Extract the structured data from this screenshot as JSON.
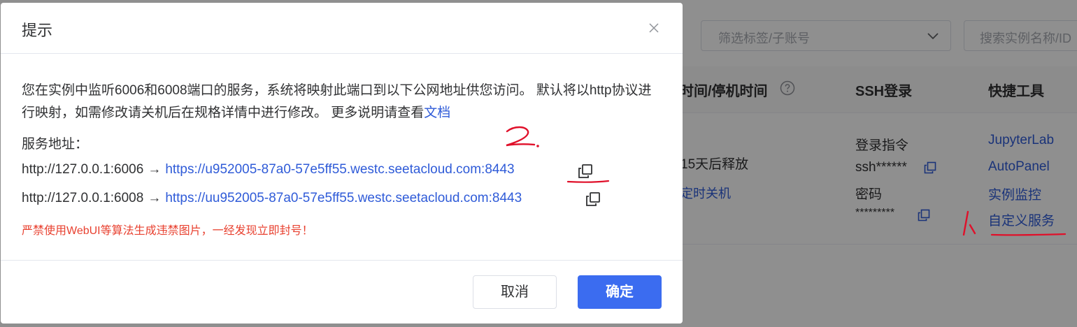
{
  "background": {
    "filter_select": {
      "placeholder": "筛选标签/子账号"
    },
    "search": {
      "placeholder": "搜索实例名称/ID"
    },
    "columns": {
      "time": "时间/停机时间",
      "ssh": "SSH登录",
      "tools": "快捷工具"
    },
    "row": {
      "release": "15天后释放",
      "shutdown_link": "定时关机",
      "ssh_login_label": "登录指令",
      "ssh_cmd": "ssh******",
      "password_label": "密码",
      "password_value": "*********",
      "tools": [
        "JupyterLab",
        "AutoPanel",
        "实例监控",
        "自定义服务"
      ]
    }
  },
  "dialog": {
    "title": "提示",
    "paragraph": "您在实例中监听6006和6008端口的服务，系统将映射此端口到以下公网地址供您访问。 默认将以http协议进行映射，如需修改请关机后在规格详情中进行修改。 更多说明请查看",
    "doc_link": "文档",
    "service_label": "服务地址：",
    "mappings": [
      {
        "local": "http://127.0.0.1:6006",
        "arrow": "→",
        "public": "https://u952005-87a0-57e5ff55.westc.seetacloud.com:8443"
      },
      {
        "local": "http://127.0.0.1:6008",
        "arrow": "→",
        "public": "https://uu952005-87a0-57e5ff55.westc.seetacloud.com:8443"
      }
    ],
    "warning": "严禁使用WebUI等算法生成违禁图片，一经发现立即封号！",
    "cancel_label": "取消",
    "ok_label": "确定"
  },
  "annotations": {
    "mark1": "1、",
    "mark2": "2."
  },
  "colors": {
    "primary": "#3b6cf0",
    "link": "#2f5bd8",
    "warning": "#e8402f",
    "annotation": "#e0102a"
  }
}
